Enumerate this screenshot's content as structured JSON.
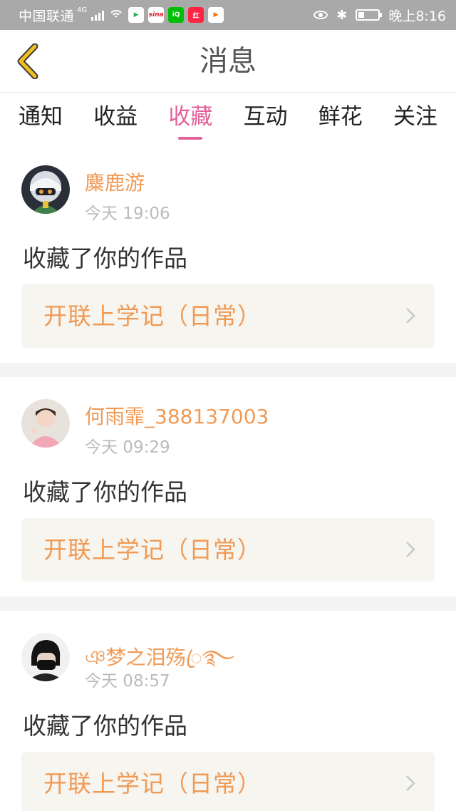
{
  "status_bar": {
    "carrier": "中国联通",
    "network": "4G",
    "app_icons": [
      "video-app-icon",
      "sina-icon",
      "iqiyi-icon",
      "xiaohongshu-icon",
      "tencent-video-icon"
    ],
    "time": "晚上8:16",
    "battery_level": 0.3
  },
  "nav": {
    "title": "消息",
    "back_icon": "chevron-left-icon"
  },
  "tabs": [
    {
      "label": "通知",
      "active": false
    },
    {
      "label": "收益",
      "active": false
    },
    {
      "label": "收藏",
      "active": true
    },
    {
      "label": "互动",
      "active": false
    },
    {
      "label": "鲜花",
      "active": false
    },
    {
      "label": "关注",
      "active": false
    }
  ],
  "messages": [
    {
      "username": "麋鹿游",
      "time": "今天 19:06",
      "action": "收藏了你的作品",
      "work_title": "开联上学记（日常）"
    },
    {
      "username": "何雨霏_388137003",
      "time": "今天 09:29",
      "action": "收藏了你的作品",
      "work_title": "开联上学记（日常）"
    },
    {
      "username": "ঞ梦之泪殇ꦿ࿐",
      "time": "今天 08:57",
      "action": "收藏了你的作品",
      "work_title": "开联上学记（日常）"
    }
  ],
  "colors": {
    "accent_pink": "#e2619a",
    "name_orange": "#f19a55",
    "back_yellow": "#f2c01e",
    "card_bg": "#f6f5ef"
  }
}
